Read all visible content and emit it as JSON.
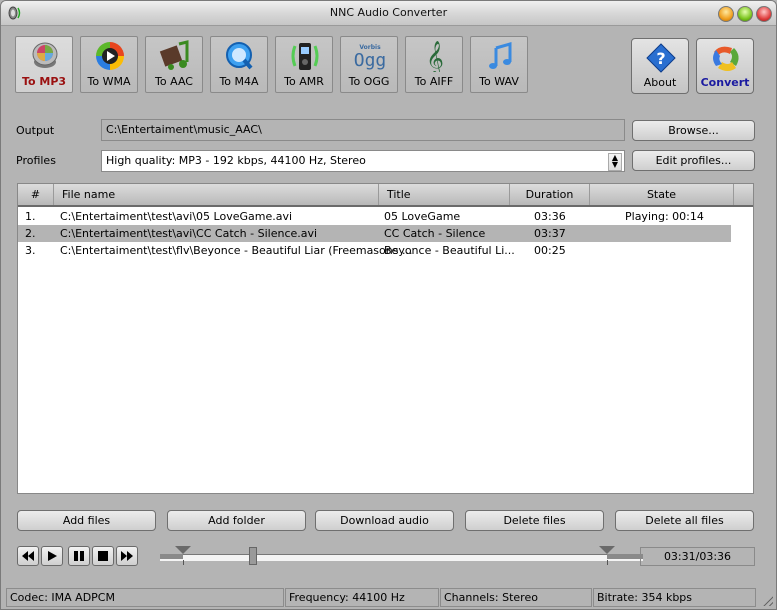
{
  "window": {
    "title": "NNC Audio Converter"
  },
  "toolbar": {
    "formats": [
      {
        "label": "To MP3",
        "icon": "mp3-speaker-icon",
        "active": true
      },
      {
        "label": "To WMA",
        "icon": "windows-media-icon",
        "active": false
      },
      {
        "label": "To AAC",
        "icon": "film-music-icon",
        "active": false
      },
      {
        "label": "To M4A",
        "icon": "quicktime-icon",
        "active": false
      },
      {
        "label": "To AMR",
        "icon": "mobile-phone-icon",
        "active": false
      },
      {
        "label": "To OGG",
        "icon": "ogg-vorbis-icon",
        "active": false
      },
      {
        "label": "To AIFF",
        "icon": "treble-clef-icon",
        "active": false
      },
      {
        "label": "To WAV",
        "icon": "music-note-icon",
        "active": false
      }
    ],
    "about_label": "About",
    "convert_label": "Convert"
  },
  "output": {
    "label": "Output",
    "value": "C:\\Entertaiment\\music_AAC\\",
    "browse_label": "Browse..."
  },
  "profiles": {
    "label": "Profiles",
    "value": "High quality: MP3 - 192 kbps, 44100 Hz, Stereo",
    "edit_label": "Edit profiles..."
  },
  "file_list": {
    "columns": [
      "#",
      "File name",
      "Title",
      "Duration",
      "State"
    ],
    "rows": [
      {
        "num": "1.",
        "file": "C:\\Entertaiment\\test\\avi\\05 LoveGame.avi",
        "title": "05 LoveGame",
        "duration": "03:36",
        "state": "Playing: 00:14",
        "selected": false
      },
      {
        "num": "2.",
        "file": "C:\\Entertaiment\\test\\avi\\CC Catch - Silence.avi",
        "title": "CC Catch - Silence",
        "duration": "03:37",
        "state": "",
        "selected": true
      },
      {
        "num": "3.",
        "file": "C:\\Entertaiment\\test\\flv\\Beyonce - Beautiful Liar (Freemasons ...",
        "title": "Beyonce - Beautiful Li...",
        "duration": "00:25",
        "state": "",
        "selected": false
      }
    ]
  },
  "actions": {
    "add_files": "Add files",
    "add_folder": "Add folder",
    "download_audio": "Download audio",
    "delete_files": "Delete files",
    "delete_all_files": "Delete all files"
  },
  "player": {
    "time": "03:31/03:36",
    "position_fraction": 0.18
  },
  "status_bar": {
    "codec": "Codec: IMA ADPCM",
    "frequency": "Frequency: 44100 Hz",
    "channels": "Channels: Stereo",
    "bitrate": "Bitrate: 354 kbps"
  },
  "colors": {
    "active_label": "#9a1010",
    "convert_label": "#1a1aa0",
    "selected_row": "#b4b4b4",
    "window_bg": "#b4b4b4"
  }
}
